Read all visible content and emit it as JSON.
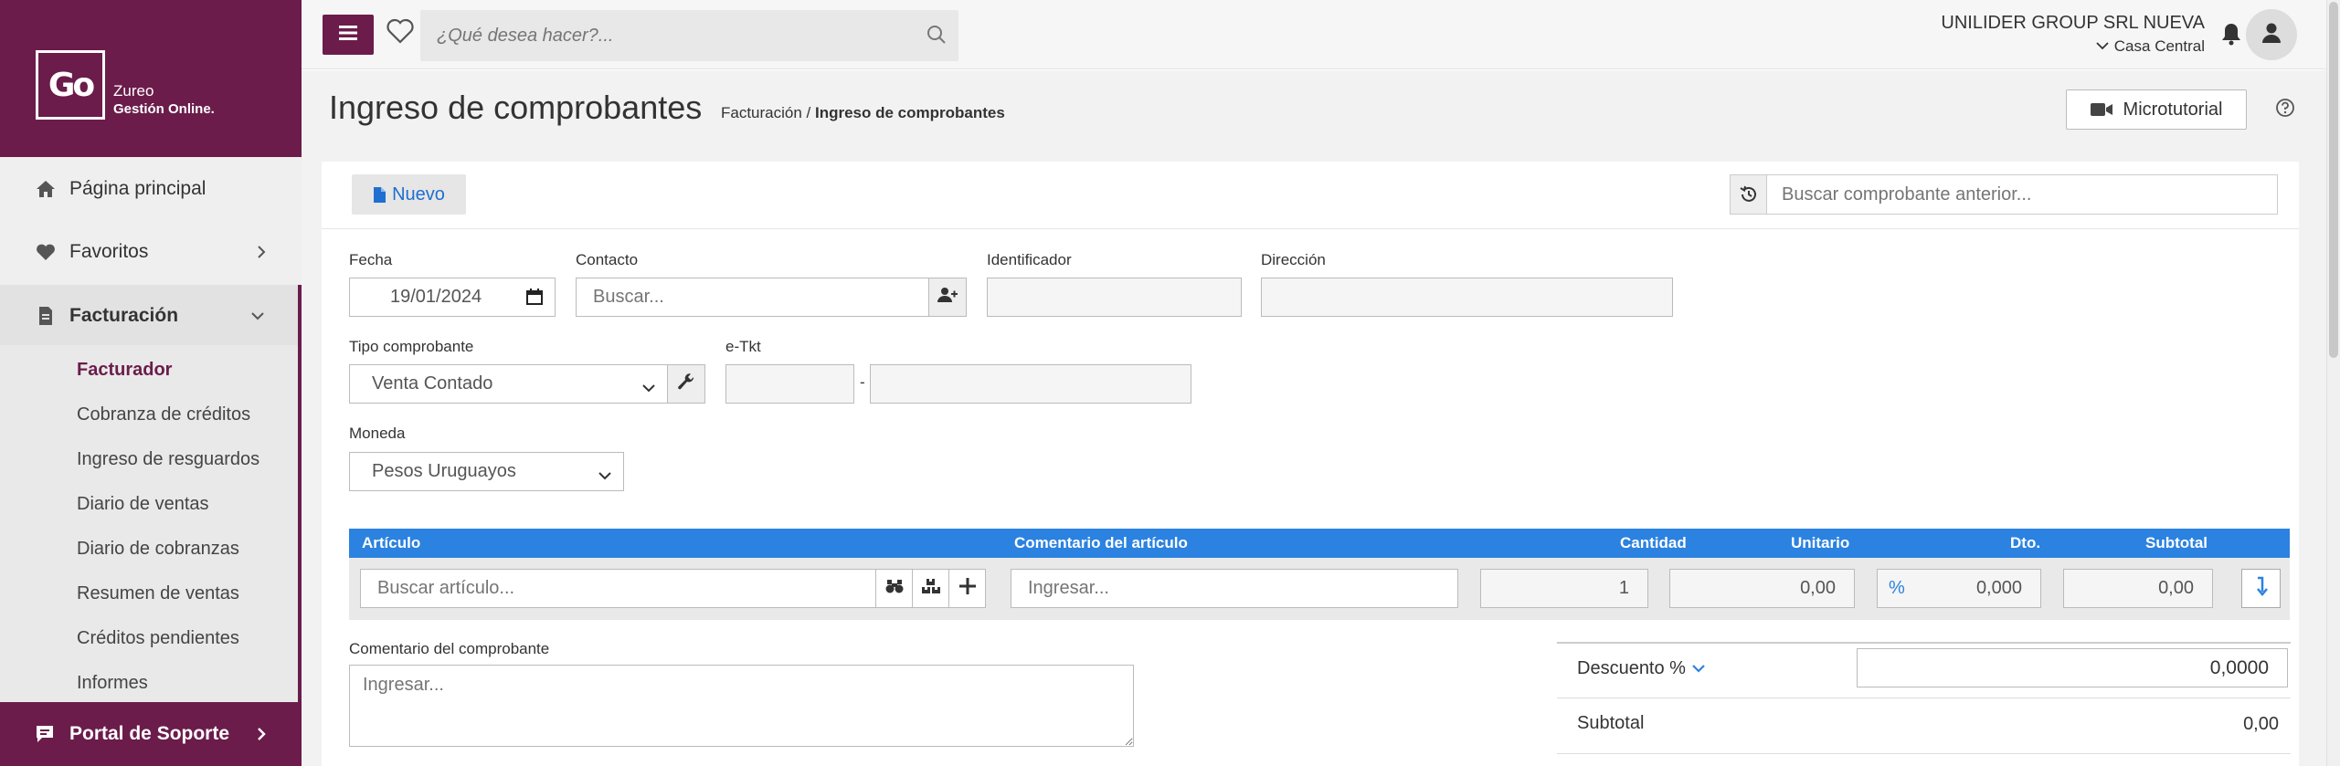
{
  "brand": {
    "logo_mark": "Go",
    "name": "Zureo",
    "tagline": "Gestión Online."
  },
  "sidebar": {
    "items": [
      {
        "label": "Página principal",
        "icon": "home-icon"
      },
      {
        "label": "Favoritos",
        "icon": "heart-icon"
      },
      {
        "label": "Facturación",
        "icon": "invoice-icon"
      }
    ],
    "sub_items": [
      {
        "label": "Facturador",
        "active": true
      },
      {
        "label": "Cobranza de créditos"
      },
      {
        "label": "Ingreso de resguardos"
      },
      {
        "label": "Diario de ventas"
      },
      {
        "label": "Diario de cobranzas"
      },
      {
        "label": "Resumen de ventas"
      },
      {
        "label": "Créditos pendientes"
      },
      {
        "label": "Informes"
      }
    ],
    "support_label": "Portal de Soporte"
  },
  "topbar": {
    "search_placeholder": "¿Qué desea hacer?...",
    "company": "UNILIDER GROUP SRL NUEVA",
    "branch": "Casa Central"
  },
  "page": {
    "title": "Ingreso de comprobantes",
    "breadcrumb_parent": "Facturación",
    "breadcrumb_sep": " / ",
    "breadcrumb_current": "Ingreso de comprobantes",
    "microtutorial_label": "Microtutorial"
  },
  "toolbar": {
    "nuevo_label": "Nuevo",
    "history_placeholder": "Buscar comprobante anterior..."
  },
  "form": {
    "fecha_label": "Fecha",
    "fecha_value": "19/01/2024",
    "contacto_label": "Contacto",
    "contacto_placeholder": "Buscar...",
    "identificador_label": "Identificador",
    "direccion_label": "Dirección",
    "tipo_label": "Tipo comprobante",
    "tipo_value": "Venta Contado",
    "etkt_label": "e-Tkt",
    "etkt_sep": "-",
    "moneda_label": "Moneda",
    "moneda_value": "Pesos Uruguayos"
  },
  "grid": {
    "headers": [
      "Artículo",
      "Comentario del artículo",
      "Cantidad",
      "Unitario",
      "Dto.",
      "Subtotal"
    ],
    "articulo_placeholder": "Buscar artículo...",
    "comentario_placeholder": "Ingresar...",
    "cantidad": "1",
    "unitario": "0,00",
    "dto_symbol": "%",
    "dto": "0,000",
    "subtotal": "0,00"
  },
  "comment": {
    "label": "Comentario del comprobante",
    "placeholder": "Ingresar..."
  },
  "totals": {
    "descuento_label": "Descuento %",
    "descuento_value": "0,0000",
    "subtotal_label": "Subtotal",
    "subtotal_value": "0,00"
  },
  "colors": {
    "brand": "#6b1c4b",
    "accent": "#2b82e0",
    "link": "#1f6fd1"
  }
}
